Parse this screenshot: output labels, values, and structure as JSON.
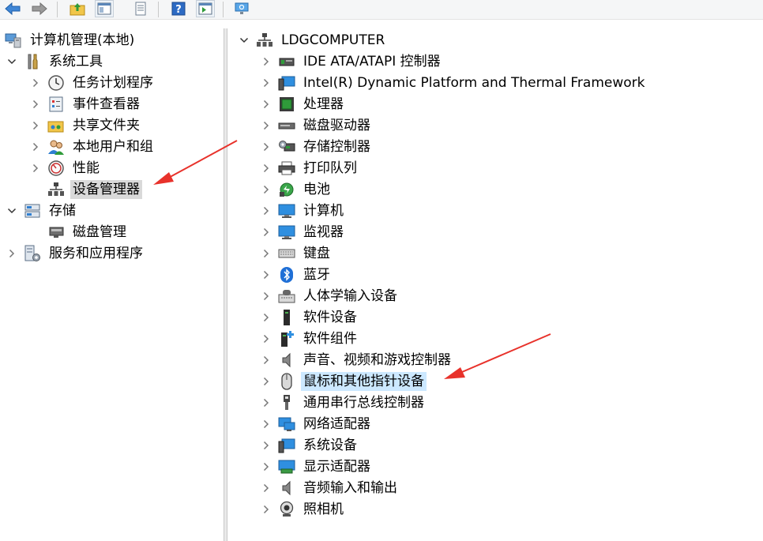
{
  "toolbar": {
    "buttons": [
      {
        "name": "back-button",
        "icon": "arrow-left-icon"
      },
      {
        "name": "forward-button",
        "icon": "arrow-right-icon"
      },
      {
        "name": "up-folder-button",
        "icon": "folder-up-icon"
      },
      {
        "name": "show-hide-tree-button",
        "icon": "console-tree-icon"
      },
      {
        "name": "properties-button",
        "icon": "properties-icon"
      },
      {
        "name": "help-button",
        "icon": "help-icon"
      },
      {
        "name": "action-pane-button",
        "icon": "action-pane-icon"
      },
      {
        "name": "scan-hardware-button",
        "icon": "monitor-scan-icon"
      }
    ]
  },
  "left_tree": {
    "root": "计算机管理(本地)",
    "items": [
      {
        "label": "系统工具",
        "level": 1,
        "expander": "down"
      },
      {
        "label": "任务计划程序",
        "level": 2,
        "expander": "right"
      },
      {
        "label": "事件查看器",
        "level": 2,
        "expander": "right"
      },
      {
        "label": "共享文件夹",
        "level": 2,
        "expander": "right"
      },
      {
        "label": "本地用户和组",
        "level": 2,
        "expander": "right"
      },
      {
        "label": "性能",
        "level": 2,
        "expander": "right"
      },
      {
        "label": "设备管理器",
        "level": 2,
        "expander": "none",
        "selected": true
      },
      {
        "label": "存储",
        "level": 1,
        "expander": "down"
      },
      {
        "label": "磁盘管理",
        "level": 2,
        "expander": "none"
      },
      {
        "label": "服务和应用程序",
        "level": 1,
        "expander": "right"
      }
    ]
  },
  "device_tree": {
    "root": "LDGCOMPUTER",
    "items": [
      "IDE ATA/ATAPI 控制器",
      "Intel(R) Dynamic Platform and Thermal Framework",
      "处理器",
      "磁盘驱动器",
      "存储控制器",
      "打印队列",
      "电池",
      "计算机",
      "监视器",
      "键盘",
      "蓝牙",
      "人体学输入设备",
      "软件设备",
      "软件组件",
      "声音、视频和游戏控制器",
      "鼠标和其他指针设备",
      "通用串行总线控制器",
      "网络适配器",
      "系统设备",
      "显示适配器",
      "音频输入和输出",
      "照相机"
    ],
    "highlighted_index": 15
  },
  "colors": {
    "annotation_arrow": "#e8322b",
    "selection": "#d9d9d9",
    "highlight": "#cce8ff"
  }
}
